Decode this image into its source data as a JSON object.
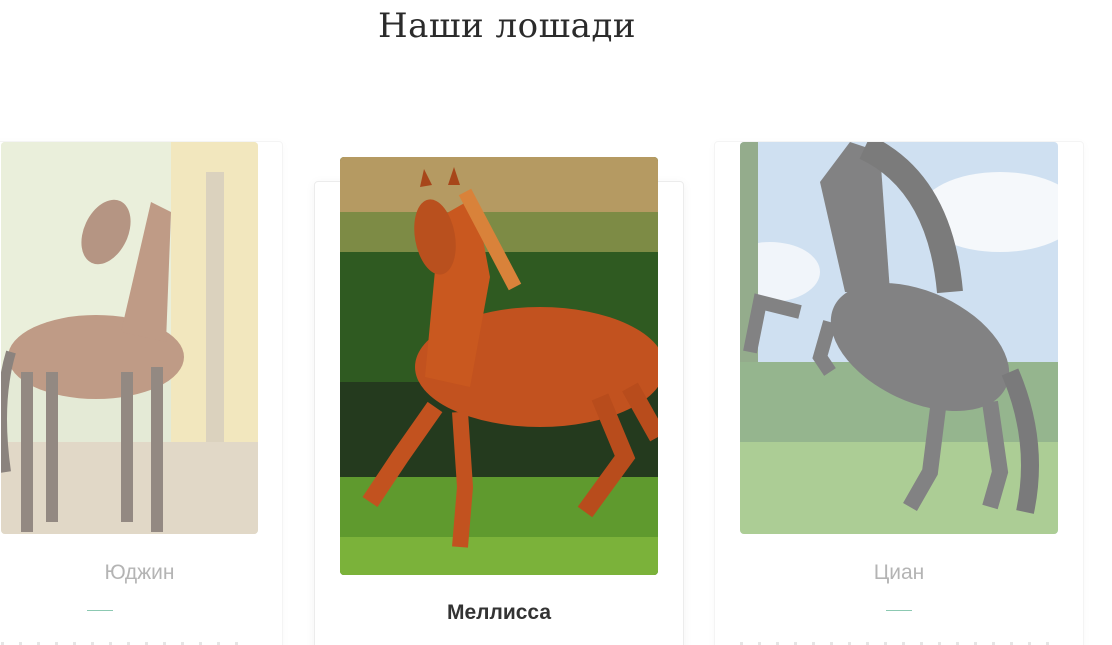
{
  "section": {
    "title": "Наши лошади"
  },
  "horses": [
    {
      "name": "Юджин",
      "state": "inactive",
      "coat": "bay",
      "image_icon": "horse-photo-icon"
    },
    {
      "name": "Меллисса",
      "state": "active",
      "coat": "chestnut",
      "image_icon": "horse-photo-icon"
    },
    {
      "name": "Циан",
      "state": "inactive",
      "coat": "black",
      "image_icon": "horse-photo-icon"
    }
  ],
  "colors": {
    "accent": "#2f9e74",
    "title": "#2b2b2b",
    "name_active": "#333333",
    "name_inactive": "#777777"
  }
}
